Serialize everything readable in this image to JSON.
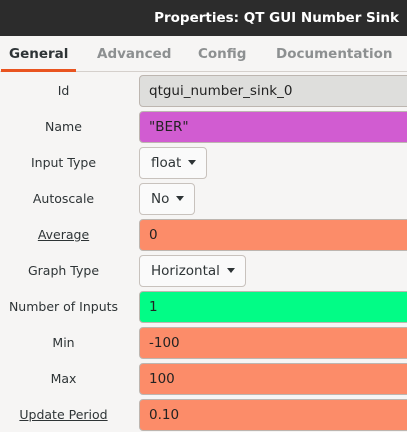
{
  "window": {
    "title": "Properties: QT GUI Number Sink"
  },
  "tabs": [
    {
      "label": "General",
      "active": true
    },
    {
      "label": "Advanced",
      "active": false
    },
    {
      "label": "Config",
      "active": false
    },
    {
      "label": "Documentation",
      "active": false
    }
  ],
  "fields": {
    "id": {
      "label": "Id",
      "value": "qtgui_number_sink_0"
    },
    "name": {
      "label": "Name",
      "value": "\"BER\""
    },
    "input_type": {
      "label": "Input Type",
      "value": "float"
    },
    "autoscale": {
      "label": "Autoscale",
      "value": "No"
    },
    "average": {
      "label": "Average",
      "value": "0"
    },
    "graph_type": {
      "label": "Graph Type",
      "value": "Horizontal"
    },
    "number_of_inputs": {
      "label": "Number of Inputs",
      "value": "1"
    },
    "min": {
      "label": "Min",
      "value": "-100"
    },
    "max": {
      "label": "Max",
      "value": "100"
    },
    "update_period": {
      "label": "Update Period",
      "value": "0.10"
    }
  },
  "colors": {
    "titlebar": "#2c2c2c",
    "tab_accent": "#e95420",
    "field_readonly": "#dededc",
    "field_string": "#d15cd1",
    "field_real": "#fc8c69",
    "field_int": "#02fc86"
  },
  "icons": {
    "dropdown": "chevron-down-icon"
  }
}
